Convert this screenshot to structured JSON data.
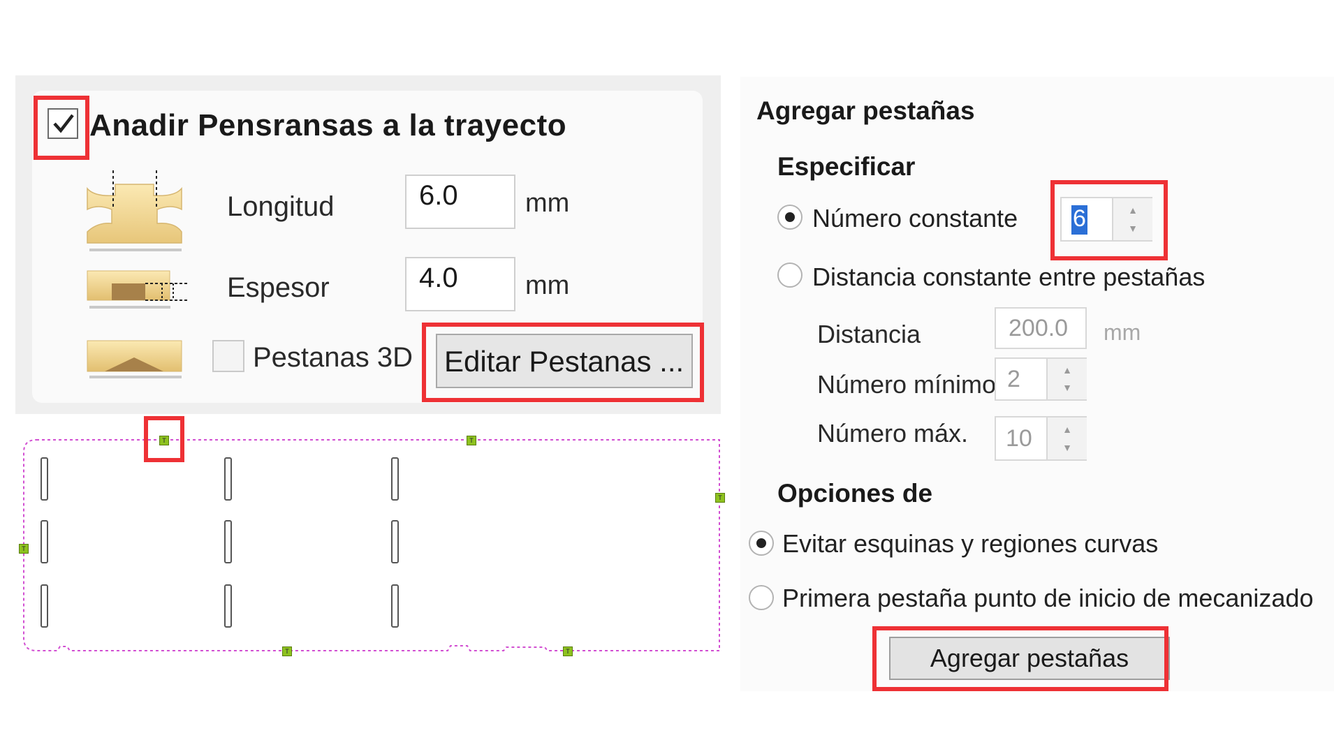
{
  "left_panel": {
    "title": "Anadir Pensransas a la trayecto",
    "title_checked": true,
    "length": {
      "label": "Longitud",
      "value": "6.0",
      "unit": "mm"
    },
    "thickness": {
      "label": "Espesor",
      "value": "4.0",
      "unit": "mm"
    },
    "tabs3d": {
      "label": "Pestanas 3D",
      "checked": false
    },
    "edit_button": "Editar Pestanas ..."
  },
  "right_panel": {
    "title": "Agregar pestañas",
    "specify_heading": "Especificar",
    "constant_number": {
      "label": "Número constante",
      "value": "6",
      "selected": true
    },
    "constant_distance": {
      "label": "Distancia constante entre pestañas",
      "selected": false
    },
    "distance": {
      "label": "Distancia",
      "value": "200.0",
      "unit": "mm"
    },
    "min_number": {
      "label": "Número mínimo",
      "value": "2"
    },
    "max_number": {
      "label": "Número máx.",
      "value": "10"
    },
    "options_heading": "Opciones de",
    "avoid_corners": {
      "label": "Evitar esquinas y regiones curvas",
      "selected": true
    },
    "first_tab_start": {
      "label": "Primera pestaña punto de inicio de mecanizado",
      "selected": false
    },
    "add_button": "Agregar pestañas"
  },
  "preview": {
    "tab_marker_glyph": "T"
  },
  "colors": {
    "highlight": "#ee3135",
    "path": "#d24fd2",
    "tab_marker": "#8ec21f"
  }
}
